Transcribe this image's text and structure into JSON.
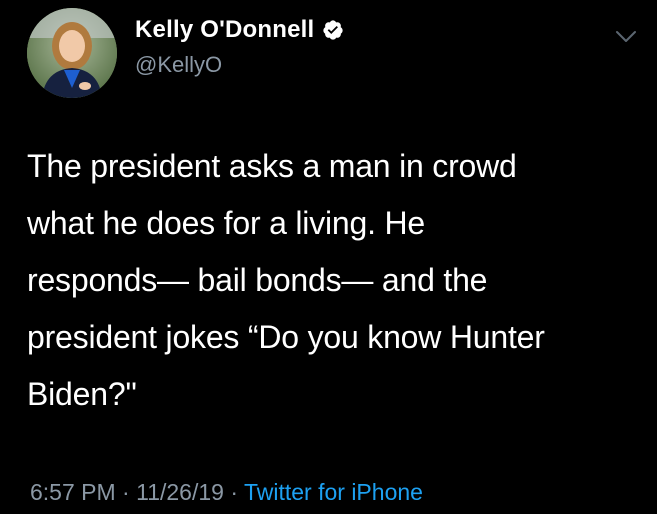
{
  "tweet": {
    "author": {
      "display_name": "Kelly O'Donnell",
      "handle": "@KellyO",
      "verified": true,
      "avatar_icon": "profile-photo"
    },
    "text": "The president asks a man in crowd\nwhat he does for a living.  He\nresponds— bail bonds— and the\npresident jokes “Do you know Hunter\nBiden?\"",
    "meta": {
      "time": "6:57 PM",
      "separator": " · ",
      "date": "11/26/19",
      "separator2": " · ",
      "source": "Twitter for iPhone"
    },
    "menu_icon": "chevron-down-icon"
  },
  "colors": {
    "background": "#000000",
    "text": "#ffffff",
    "secondary": "#8b98a5",
    "link": "#1da1f2",
    "verified_badge": "#ffffff"
  }
}
